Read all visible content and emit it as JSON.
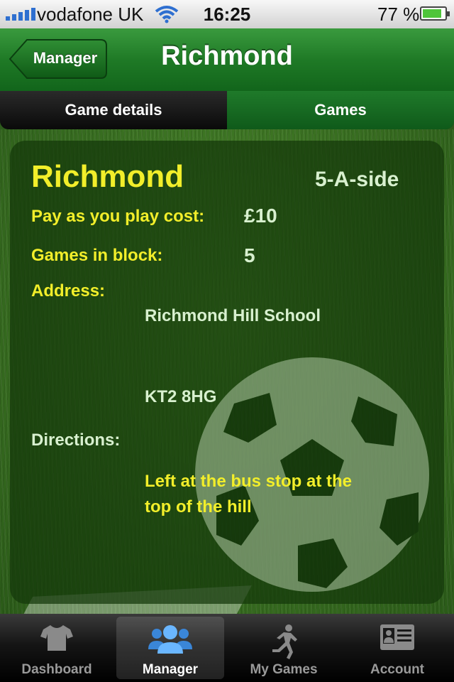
{
  "status_bar": {
    "carrier": "vodafone UK",
    "time": "16:25",
    "battery": "77 %",
    "battery_level": 0.77
  },
  "nav": {
    "back_label": "Manager",
    "title": "Richmond"
  },
  "segments": [
    {
      "label": "Game details",
      "selected": true
    },
    {
      "label": "Games",
      "selected": false
    }
  ],
  "venue": {
    "name": "Richmond",
    "format": "5-A-side",
    "cost_label": "Pay as you play cost:",
    "cost_value": "£10",
    "games_label": "Games in block:",
    "games_value": "5",
    "address_label": "Address:",
    "address_line1": "Richmond Hill School",
    "postcode": "KT2 8HG",
    "directions_label": "Directions:",
    "directions_line1": "Left at the bus stop at the",
    "directions_line2": "top of the hill"
  },
  "tabs": [
    {
      "label": "Dashboard",
      "icon": "shirt-icon",
      "active": false
    },
    {
      "label": "Manager",
      "icon": "people-icon",
      "active": true
    },
    {
      "label": "My Games",
      "icon": "runner-icon",
      "active": false
    },
    {
      "label": "Account",
      "icon": "id-card-icon",
      "active": false
    }
  ],
  "colors": {
    "nav_green": "#1f7a26",
    "label_yellow": "#f2ee2a",
    "value_pale": "#d8f0cf"
  }
}
